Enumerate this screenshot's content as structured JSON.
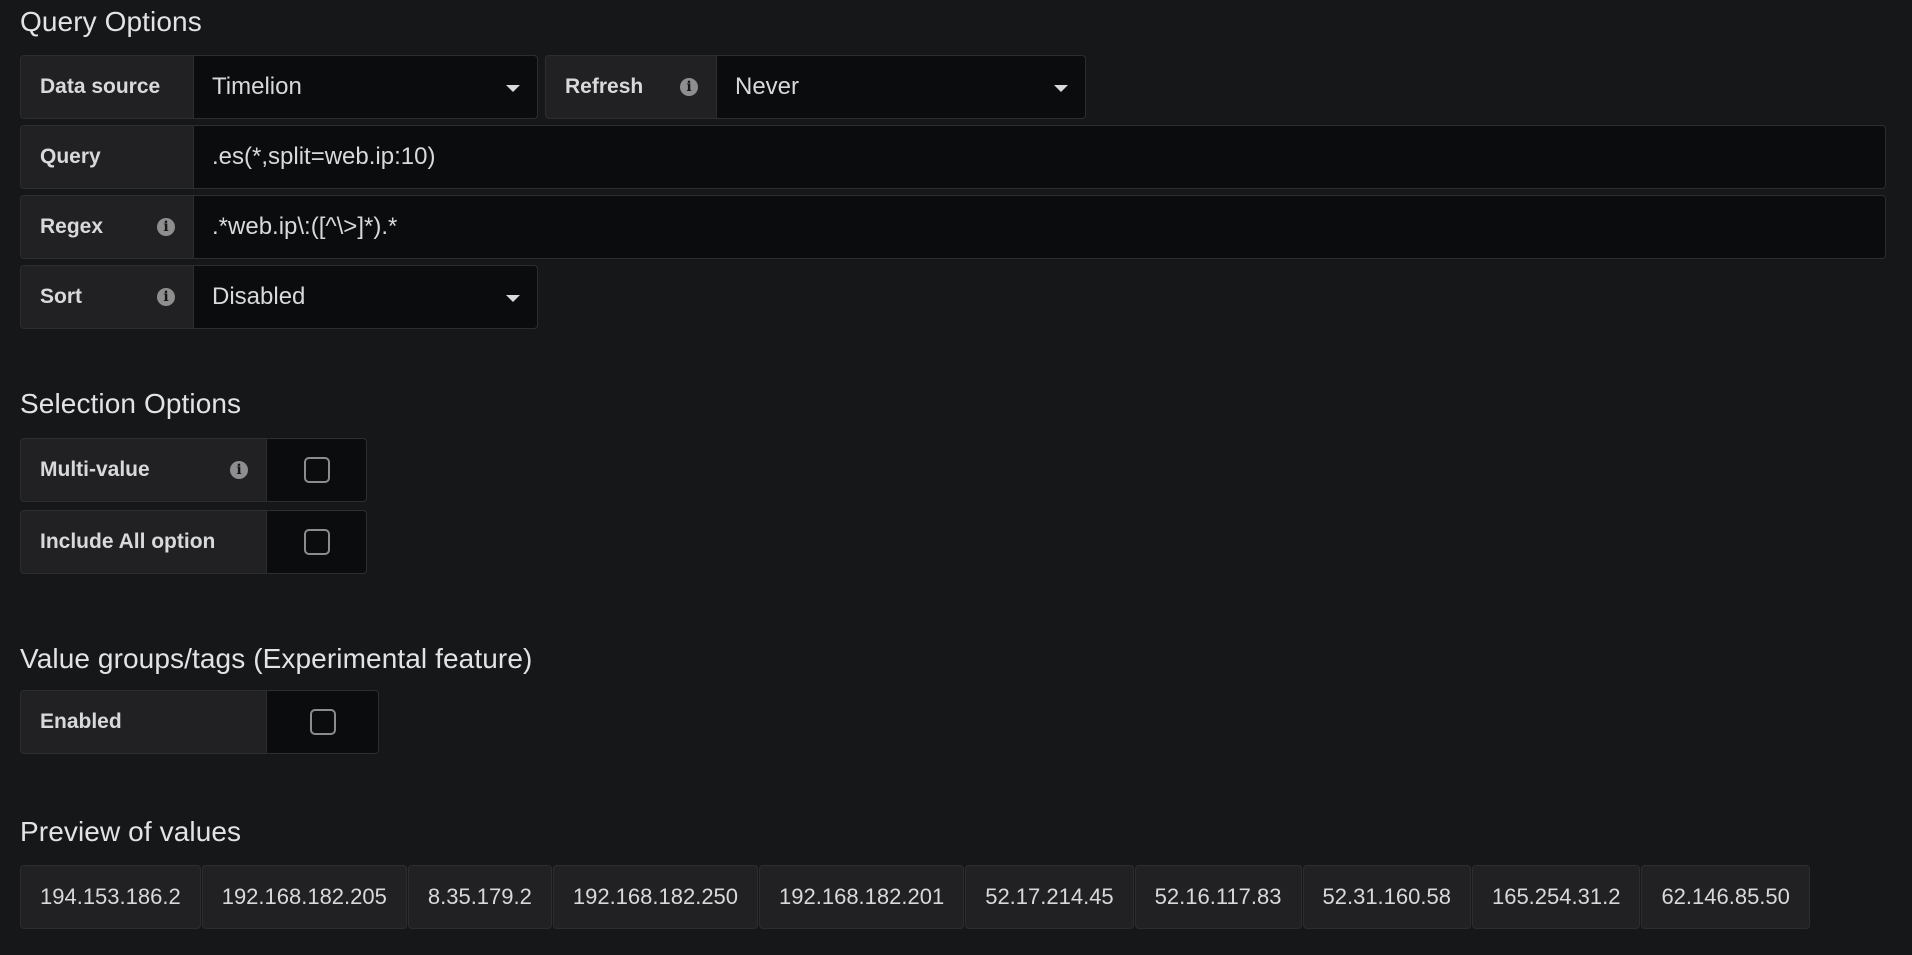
{
  "query_options": {
    "title": "Query Options",
    "data_source": {
      "label": "Data source",
      "value": "Timelion"
    },
    "refresh": {
      "label": "Refresh",
      "value": "Never"
    },
    "query": {
      "label": "Query",
      "value": ".es(*,split=web.ip:10)"
    },
    "regex": {
      "label": "Regex",
      "value": ".*web.ip\\:([^\\>]*).*"
    },
    "sort": {
      "label": "Sort",
      "value": "Disabled"
    }
  },
  "selection_options": {
    "title": "Selection Options",
    "multi_value": {
      "label": "Multi-value",
      "checked": false
    },
    "include_all": {
      "label": "Include All option",
      "checked": false
    }
  },
  "value_groups": {
    "title": "Value groups/tags (Experimental feature)",
    "enabled": {
      "label": "Enabled",
      "checked": false
    }
  },
  "preview": {
    "title": "Preview of values",
    "values": [
      "194.153.186.2",
      "192.168.182.205",
      "8.35.179.2",
      "192.168.182.250",
      "192.168.182.201",
      "52.17.214.45",
      "52.16.117.83",
      "52.31.160.58",
      "165.254.31.2",
      "62.146.85.50"
    ]
  },
  "icons": {
    "info": "info-icon",
    "dropdown": "caret-down-icon",
    "checkbox": "checkbox-unchecked-icon"
  },
  "colors": {
    "background": "#161719",
    "label_bg": "#212124",
    "input_bg": "#0b0c0e",
    "text": "#d8d9da"
  }
}
